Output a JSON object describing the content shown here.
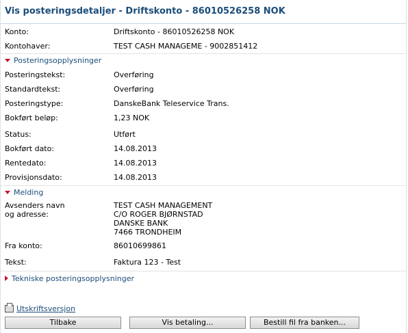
{
  "title": "Vis posteringsdetaljer - Driftskonto - 86010526258 NOK",
  "account": [
    {
      "label": "Konto:",
      "value": "Driftskonto - 86010526258 NOK"
    },
    {
      "label": "Kontohaver:",
      "value": "TEST CASH MANAGEME - 9002851412"
    }
  ],
  "sections": {
    "posting": "Posteringsopplysninger",
    "message": "Melding",
    "technical": "Tekniske posteringsopplysninger"
  },
  "posting": [
    {
      "label": "Posteringstekst:",
      "value": "Overføring"
    },
    {
      "label": "Standardtekst:",
      "value": "Overføring"
    },
    {
      "label": "Posteringstype:",
      "value": "DanskeBank Teleservice Trans."
    },
    {
      "label": "Bokført beløp:",
      "value": "1,23 NOK"
    },
    {
      "label": "Status:",
      "value": "Utført"
    },
    {
      "label": "Bokført dato:",
      "value": "14.08.2013"
    },
    {
      "label": "Rentedato:",
      "value": "14.08.2013"
    },
    {
      "label": "Provisjonsdato:",
      "value": "14.08.2013"
    }
  ],
  "message": {
    "sender_label_1": "Avsenders navn",
    "sender_label_2": "og adresse:",
    "address": [
      "TEST CASH MANAGEMENT",
      "C/O ROGER BJØRNSTAD",
      "DANSKE BANK",
      "7466 TRONDHEIM"
    ],
    "from_label": "Fra konto:",
    "from_value": "86010699861",
    "text_label": "Tekst:",
    "text_value": "Faktura 123 - Test"
  },
  "print_link": "Utskriftsversjon",
  "buttons": {
    "back": "Tilbake",
    "show_payment": "Vis betaling...",
    "order_file": "Bestill fil fra banken..."
  },
  "icons": {
    "expanded": "triangle-down-icon",
    "collapsed": "triangle-right-icon",
    "print": "printer-icon"
  },
  "colors": {
    "title": "#1b4d7a",
    "arrow": "#c8102e",
    "link": "#1b4d7a"
  }
}
